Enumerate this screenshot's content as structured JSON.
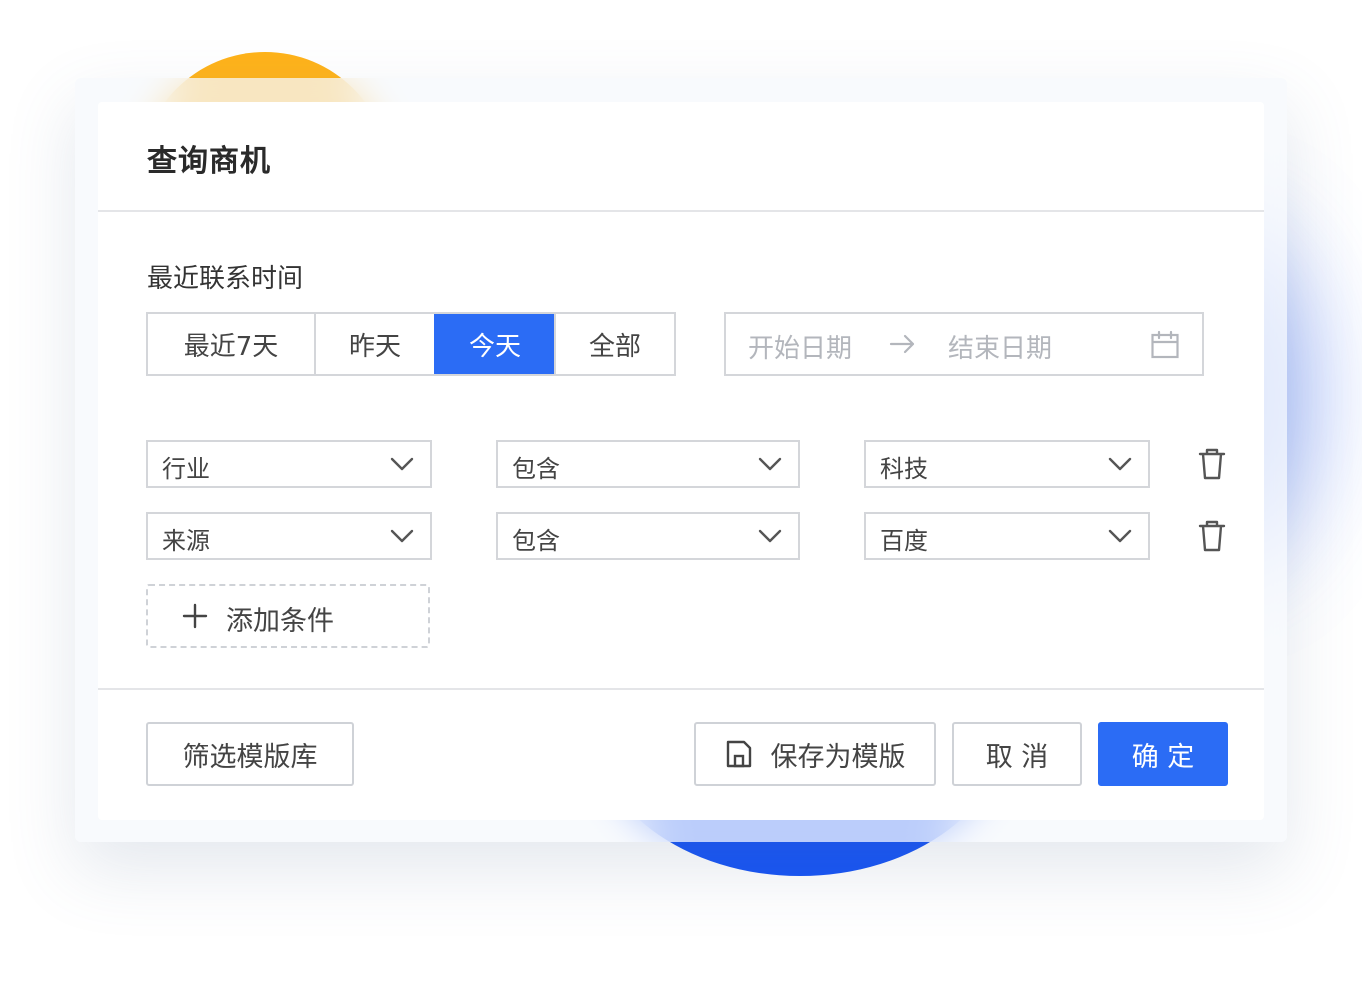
{
  "dialog": {
    "title": "查询商机"
  },
  "time_filter": {
    "label": "最近联系时间",
    "options": [
      "最近7天",
      "昨天",
      "今天",
      "全部"
    ],
    "selected": "今天",
    "date_range": {
      "start_placeholder": "开始日期",
      "end_placeholder": "结束日期",
      "icon": "calendar-icon"
    }
  },
  "conditions": [
    {
      "field": "行业",
      "operator": "包含",
      "value": "科技"
    },
    {
      "field": "来源",
      "operator": "包含",
      "value": "百度"
    }
  ],
  "add_condition": {
    "label": "添加条件",
    "icon": "plus-icon"
  },
  "footer": {
    "template_library_label": "筛选模版库",
    "save_template_label": "保存为模版",
    "save_icon": "save-icon",
    "cancel_label": "取 消",
    "confirm_label": "确 定"
  },
  "colors": {
    "primary": "#2b6cf5",
    "accent_orange": "#ffb31a",
    "accent_blue": "#1553f5"
  }
}
